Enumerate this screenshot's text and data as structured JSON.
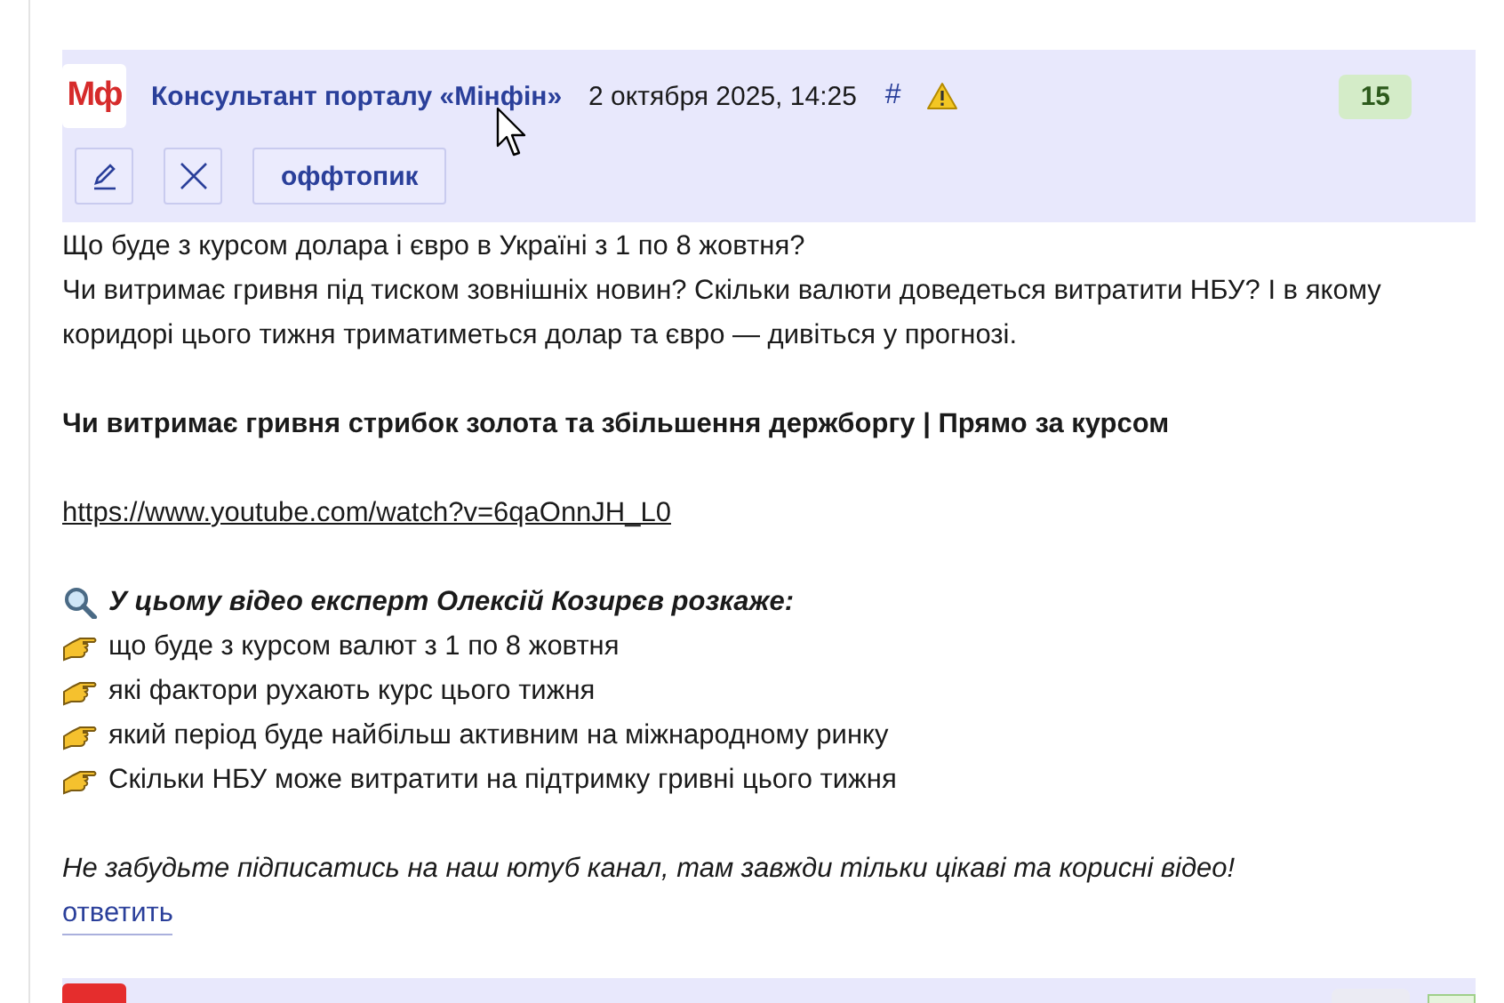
{
  "comment": {
    "avatar": "Мф",
    "author": "Консультант порталу «Мінфін»",
    "date": "2 октября 2025, 14:25",
    "anchor": "#",
    "score": "15",
    "tag_button": "оффтопик",
    "body": [
      {
        "kind": "text",
        "text": "Що буде з курсом долара і євро в Україні з 1 по 8 жовтня?"
      },
      {
        "kind": "text",
        "text": "Чи витримає гривня під тиском зовнішніх новин? Скільки валюти доведеться витратити НБУ? І в якому коридорі цього тижня триматиметься долар та євро — дивіться у прогнозі."
      },
      {
        "kind": "bold",
        "text": "Чи витримає гривня стрибок золота та збільшення держборгу | Прямо за курсом"
      },
      {
        "kind": "link",
        "text": "https://www.youtube.com/watch?v=6qaOnnJH_L0"
      },
      {
        "kind": "heading",
        "text": "У цьому відео експерт Олексій Козирєв розкаже:"
      },
      {
        "kind": "bullet",
        "text": "що буде з курсом валют з 1 по 8 жовтня"
      },
      {
        "kind": "bullet",
        "text": "які фактори рухають курс цього тижня"
      },
      {
        "kind": "bullet",
        "text": "який період буде найбільш активним на міжнародному ринку"
      },
      {
        "kind": "bullet",
        "text": "Скільки НБУ може витратити на підтримку гривні цього тижня"
      },
      {
        "kind": "italic",
        "text": "Не забудьте підписатись на наш ютуб канал, там завжди тільки цікаві та корисні відео!"
      }
    ],
    "reply": "ответить"
  }
}
